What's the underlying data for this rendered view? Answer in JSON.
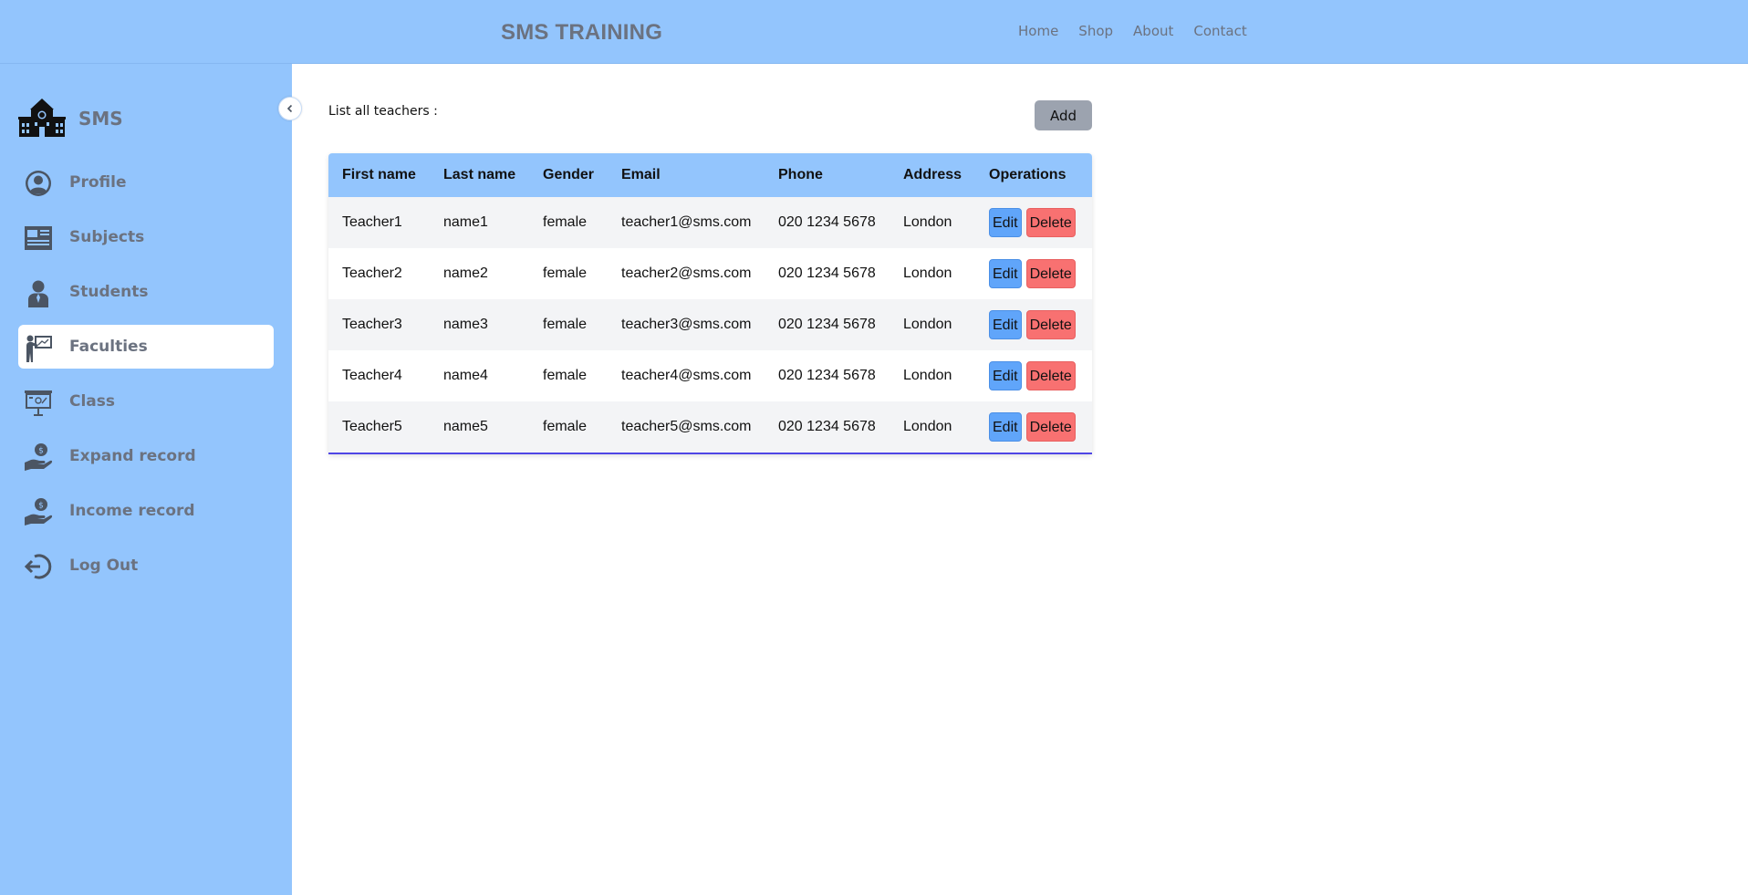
{
  "header": {
    "brand": "SMS TRAINING",
    "nav": [
      "Home",
      "Shop",
      "About",
      "Contact"
    ]
  },
  "sidebar": {
    "logo_text": "SMS",
    "items": [
      {
        "label": "Profile",
        "icon": "user-circle-icon",
        "active": false
      },
      {
        "label": "Subjects",
        "icon": "subjects-icon",
        "active": false
      },
      {
        "label": "Students",
        "icon": "student-icon",
        "active": false
      },
      {
        "label": "Faculties",
        "icon": "teacher-board-icon",
        "active": true
      },
      {
        "label": "Class",
        "icon": "classroom-board-icon",
        "active": false
      },
      {
        "label": "Expand record",
        "icon": "money-hand-icon",
        "active": false
      },
      {
        "label": "Income record",
        "icon": "money-hand-icon",
        "active": false
      },
      {
        "label": "Log Out",
        "icon": "logout-icon",
        "active": false
      }
    ]
  },
  "main": {
    "title": "List all teachers :",
    "add_label": "Add",
    "columns": [
      "First name",
      "Last name",
      "Gender",
      "Email",
      "Phone",
      "Address",
      "Operations"
    ],
    "edit_label": "Edit",
    "delete_label": "Delete",
    "rows": [
      {
        "first": "Teacher1",
        "last": "name1",
        "gender": "female",
        "email": "teacher1@sms.com",
        "phone": "020 1234 5678",
        "address": "London"
      },
      {
        "first": "Teacher2",
        "last": "name2",
        "gender": "female",
        "email": "teacher2@sms.com",
        "phone": "020 1234 5678",
        "address": "London"
      },
      {
        "first": "Teacher3",
        "last": "name3",
        "gender": "female",
        "email": "teacher3@sms.com",
        "phone": "020 1234 5678",
        "address": "London"
      },
      {
        "first": "Teacher4",
        "last": "name4",
        "gender": "female",
        "email": "teacher4@sms.com",
        "phone": "020 1234 5678",
        "address": "London"
      },
      {
        "first": "Teacher5",
        "last": "name5",
        "gender": "female",
        "email": "teacher5@sms.com",
        "phone": "020 1234 5678",
        "address": "London"
      }
    ]
  },
  "colors": {
    "accent": "#93c5fd",
    "edit": "#60a5fa",
    "delete": "#f87171",
    "add": "#9ca3af",
    "muted_text": "#6b7280"
  }
}
